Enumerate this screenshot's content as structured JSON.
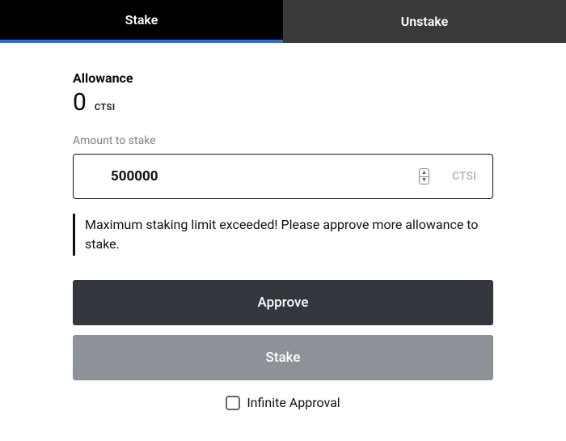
{
  "tabs": {
    "active": "Stake",
    "inactive": "Unstake"
  },
  "allowance": {
    "label": "Allowance",
    "value": "0",
    "unit": "CTSI"
  },
  "amount": {
    "label": "Amount to stake",
    "value": "500000",
    "unit": "CTSI"
  },
  "warning": "Maximum staking limit exceeded! Please approve more allowance to stake.",
  "buttons": {
    "approve": "Approve",
    "stake": "Stake"
  },
  "infinite": {
    "label": "Infinite Approval",
    "checked": false
  }
}
